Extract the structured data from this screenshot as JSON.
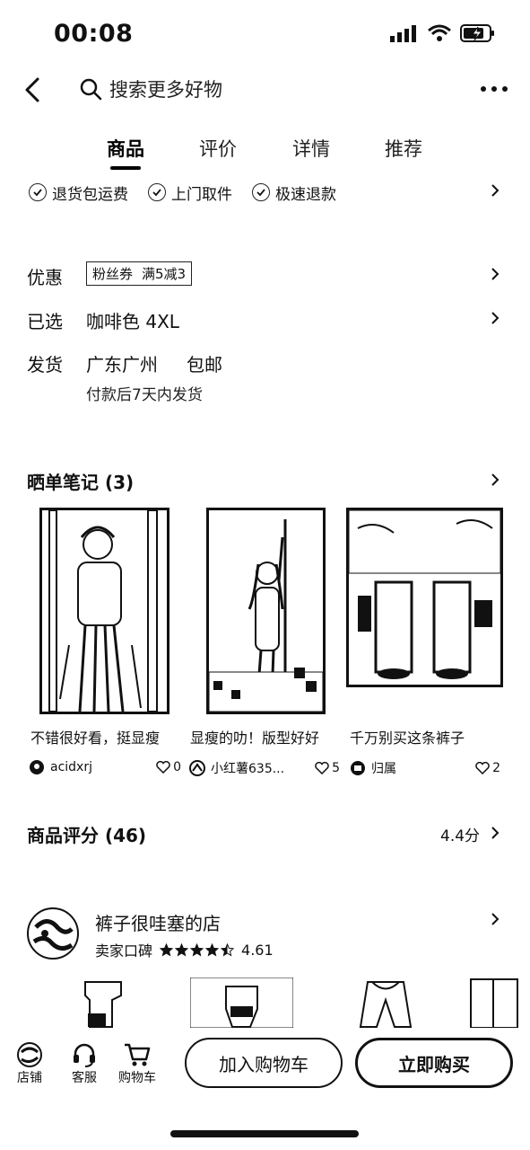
{
  "status_bar": {
    "time": "00:08"
  },
  "topbar": {
    "search_placeholder": "搜索更多好物"
  },
  "tabs": [
    {
      "label": "商品"
    },
    {
      "label": "评价"
    },
    {
      "label": "详情"
    },
    {
      "label": "推荐"
    }
  ],
  "services": [
    {
      "label": "退货包运费"
    },
    {
      "label": "上门取件"
    },
    {
      "label": "极速退款"
    }
  ],
  "promo": {
    "label": "优惠",
    "coupon_tag": "粉丝券",
    "coupon_value": "满5减3"
  },
  "selected": {
    "label": "已选",
    "value": "咖啡色 4XL"
  },
  "shipping": {
    "label": "发货",
    "origin": "广东广州",
    "free": "包邮",
    "note": "付款后7天内发货"
  },
  "notes": {
    "title": "晒单笔记 (3)",
    "items": [
      {
        "caption": "不错很好看，挺显瘦",
        "author": "acidxrj",
        "likes": "0"
      },
      {
        "caption": "显瘦的叻！版型好好",
        "author": "小红薯635...",
        "likes": "5"
      },
      {
        "caption": "千万别买这条裤子",
        "author": "归属",
        "likes": "2"
      }
    ]
  },
  "reviews": {
    "title": "商品评分 (46)",
    "score": "4.4分"
  },
  "shop": {
    "name": "裤子很哇塞的店",
    "reputation_label": "卖家口碑",
    "rating": "4.61",
    "stars": 4.5
  },
  "bottom_bar": {
    "shop_label": "店铺",
    "service_label": "客服",
    "cart_label": "购物车",
    "add_to_cart": "加入购物车",
    "buy_now": "立即购买"
  }
}
